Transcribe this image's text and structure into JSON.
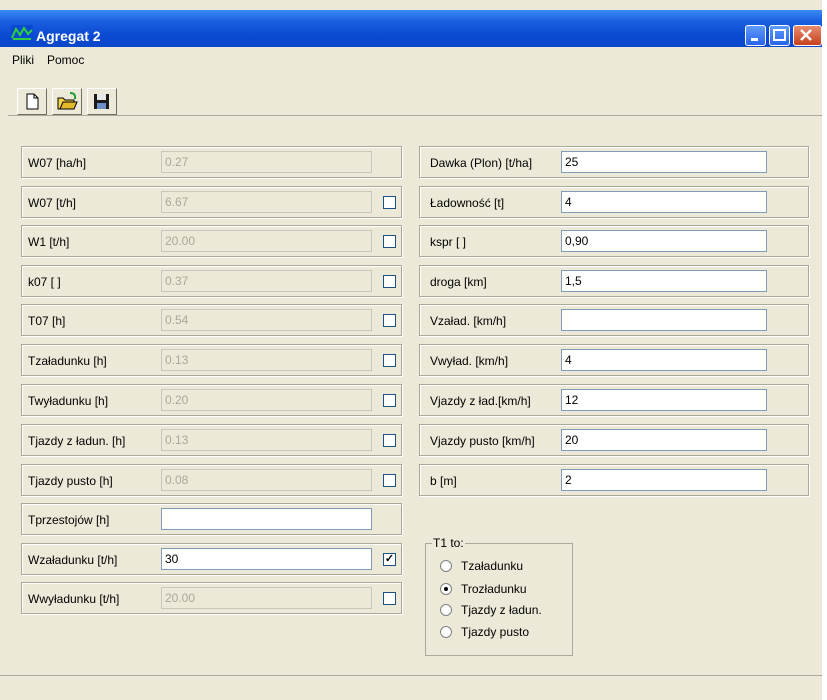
{
  "window": {
    "title": "Agregat 2"
  },
  "menu": [
    "Pliki",
    "Pomoc"
  ],
  "toolbar": {
    "buttons": [
      "new-document-icon",
      "open-folder-icon",
      "save-disk-icon"
    ]
  },
  "left_rows": [
    {
      "label": "W07 [ha/h]",
      "value": "0.27",
      "disabled": true,
      "checkbox": null
    },
    {
      "label": "W07 [t/h]",
      "value": "6.67",
      "disabled": true,
      "checkbox": false
    },
    {
      "label": "W1 [t/h]",
      "value": "20.00",
      "disabled": true,
      "checkbox": false
    },
    {
      "label": "k07 [ ]",
      "value": "0.37",
      "disabled": true,
      "checkbox": false
    },
    {
      "label": "T07 [h]",
      "value": "0.54",
      "disabled": true,
      "checkbox": false
    },
    {
      "label": "Tzaładunku [h]",
      "value": "0.13",
      "disabled": true,
      "checkbox": false
    },
    {
      "label": "Twyładunku [h]",
      "value": "0.20",
      "disabled": true,
      "checkbox": false
    },
    {
      "label": "Tjazdy z ładun. [h]",
      "value": "0.13",
      "disabled": true,
      "checkbox": false
    },
    {
      "label": "Tjazdy pusto [h]",
      "value": "0.08",
      "disabled": true,
      "checkbox": false
    },
    {
      "label": "Tprzestojów [h]",
      "value": "",
      "disabled": false,
      "checkbox": null
    },
    {
      "label": "Wzaładunku [t/h]",
      "value": "30",
      "disabled": false,
      "checkbox": true
    },
    {
      "label": "Wwyładunku [t/h]",
      "value": "20.00",
      "disabled": true,
      "checkbox": false
    }
  ],
  "right_rows": [
    {
      "label": "Dawka (Plon) [t/ha]",
      "value": "25"
    },
    {
      "label": "Ładowność [t]",
      "value": "4"
    },
    {
      "label": "kspr [ ]",
      "value": "0,90"
    },
    {
      "label": "droga [km]",
      "value": "1,5"
    },
    {
      "label": "Vzaład.  [km/h]",
      "value": ""
    },
    {
      "label": "Vwyład.  [km/h]",
      "value": "4"
    },
    {
      "label": "Vjazdy z ład.[km/h]",
      "value": "12"
    },
    {
      "label": "Vjazdy pusto [km/h]",
      "value": "20"
    },
    {
      "label": "b [m]",
      "value": "2"
    }
  ],
  "t1_group": {
    "title": "T1 to:",
    "options": [
      {
        "label": "Tzaładunku",
        "selected": false
      },
      {
        "label": "Trozładunku",
        "selected": true
      },
      {
        "label": "Tjazdy z ładun.",
        "selected": false
      },
      {
        "label": "Tjazdy pusto",
        "selected": false
      }
    ]
  },
  "colors": {
    "titlebar": "#0a49d2",
    "face": "#ece9d8",
    "border": "#aca899"
  }
}
